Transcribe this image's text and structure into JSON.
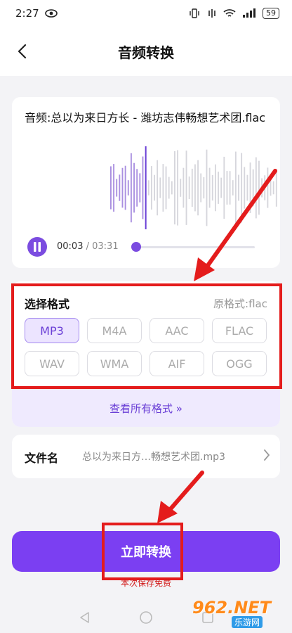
{
  "status_bar": {
    "time": "2:27",
    "battery": "59"
  },
  "header": {
    "title": "音频转换"
  },
  "player": {
    "track_name": "音频:总以为来日方长 - 潍坊志伟畅想艺术团.flac",
    "current_time": "00:03",
    "separator": " / ",
    "total_time": "03:31",
    "progress_fraction": 0.014
  },
  "format": {
    "title": "选择格式",
    "original": "原格式:flac",
    "options": [
      "MP3",
      "M4A",
      "AAC",
      "FLAC",
      "WAV",
      "WMA",
      "AIF",
      "OGG"
    ],
    "selected": "MP3",
    "view_all": "查看所有格式 »"
  },
  "filename": {
    "label": "文件名",
    "value": "总以为来日方…畅想艺术团.mp3"
  },
  "convert_button": {
    "label": "立即转换"
  },
  "save_note": "本次保存免费",
  "watermark": {
    "logo": "962.NET",
    "sub": "乐游网"
  },
  "colors": {
    "accent": "#7b3ff2",
    "highlight": "#e41c1c",
    "selected_bg": "#ece4ff"
  }
}
